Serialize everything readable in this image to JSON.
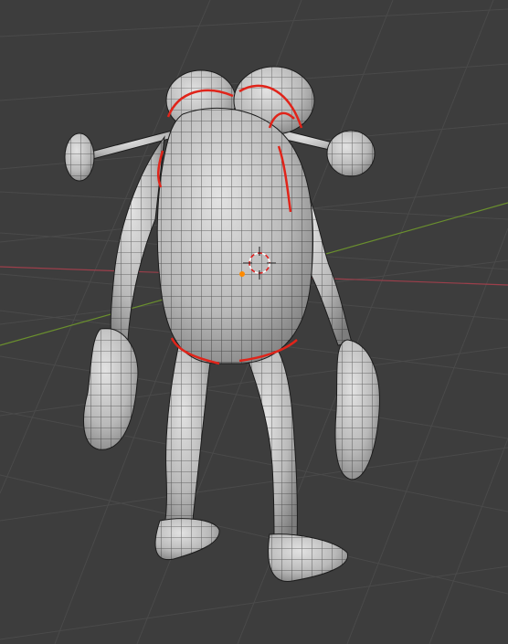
{
  "app": {
    "name": "3D Viewport"
  },
  "viewport": {
    "background": "#3d3d3d",
    "grid_line_color": "#4a4a4a",
    "x_axis_color": "#9c3f4b",
    "y_axis_color": "#6a8f2e"
  },
  "model": {
    "object": "creature-character",
    "display": "wireframe-on-shaded",
    "mesh_color": "#c8c8c8",
    "wire_color": "#1a1a1a",
    "seam_color": "#e0241a",
    "origin_color": "#ff8a00"
  },
  "cursor": {
    "type": "3d-cursor",
    "colors": [
      "#ffffff",
      "#e02020"
    ]
  }
}
